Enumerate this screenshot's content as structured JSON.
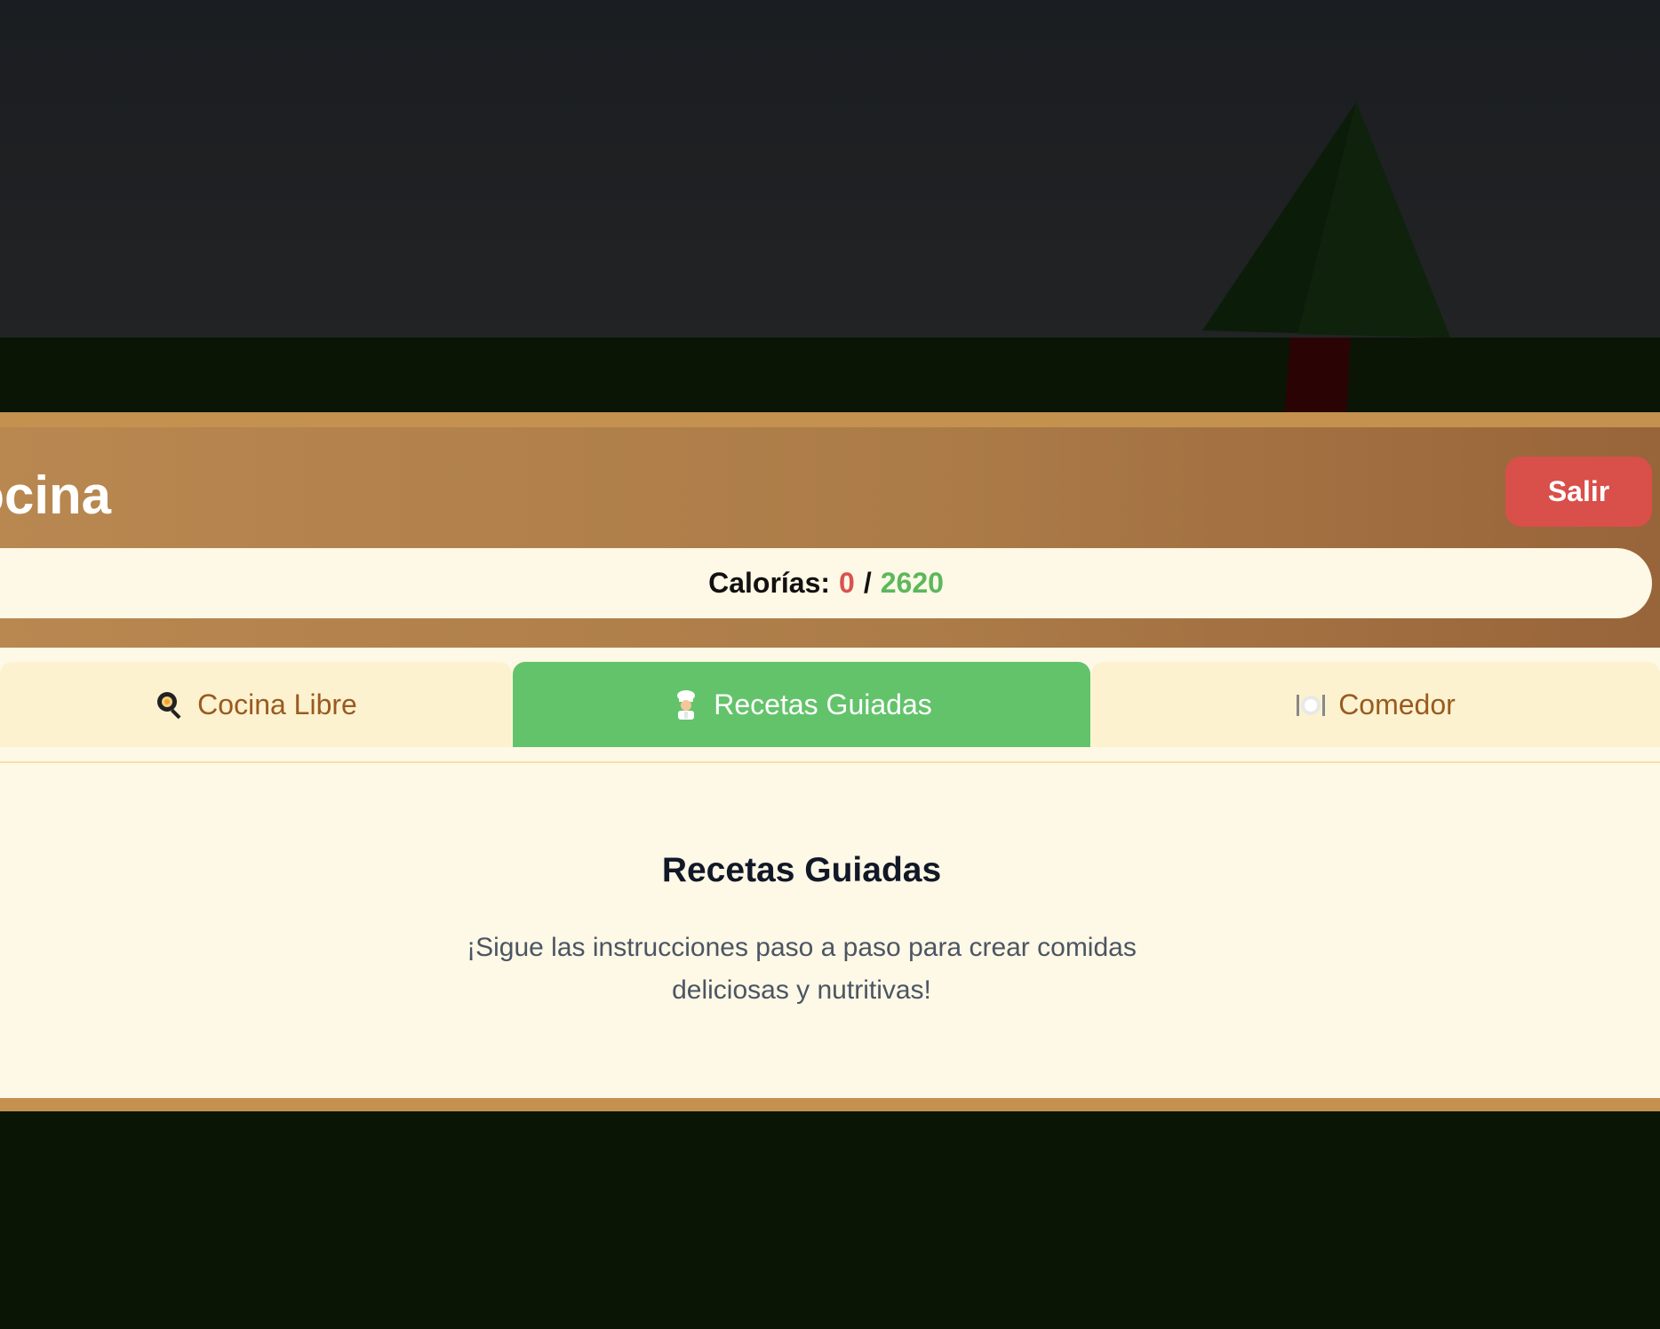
{
  "header": {
    "title": "Cocina",
    "exit_label": "Salir"
  },
  "calories": {
    "label": "Calorías:",
    "current": "0",
    "separator": "/",
    "goal": "2620"
  },
  "tabs": [
    {
      "label": "Cocina Libre",
      "icon": "frying-pan-icon",
      "active": false
    },
    {
      "label": "Recetas Guiadas",
      "icon": "chef-icon",
      "active": true
    },
    {
      "label": "Comedor",
      "icon": "plate-cutlery-icon",
      "active": false
    }
  ],
  "content": {
    "title": "Recetas Guiadas",
    "description": "¡Sigue las instrucciones paso a paso para crear comidas deliciosas y nutritivas!"
  },
  "colors": {
    "accent_active_tab": "#63c36b",
    "exit_button": "#d94f4a",
    "calories_current": "#d9534f",
    "calories_goal": "#5cb85c",
    "panel_border": "#c4914f"
  }
}
